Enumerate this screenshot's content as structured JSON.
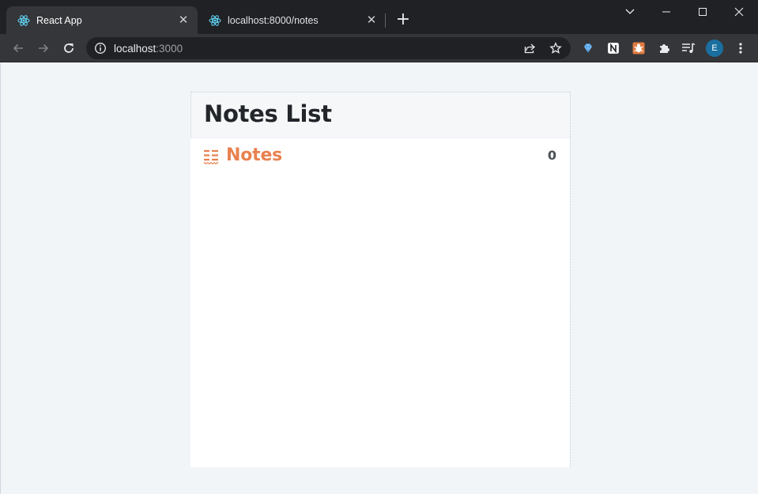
{
  "browser": {
    "tabs": [
      {
        "title": "React App",
        "active": true
      },
      {
        "title": "localhost:8000/notes",
        "active": false
      }
    ],
    "address": {
      "host": "localhost",
      "port": ":3000"
    },
    "avatar_letter": "E",
    "colors": {
      "tabstrip": "#202124",
      "toolbar": "#35363a",
      "react_logo": "#61dafb"
    }
  },
  "app": {
    "title": "Notes List",
    "section_label": "Notes",
    "note_count": "0",
    "colors": {
      "accent": "#e8814f",
      "title": "#22252a",
      "background": "#f2f5f8"
    }
  }
}
